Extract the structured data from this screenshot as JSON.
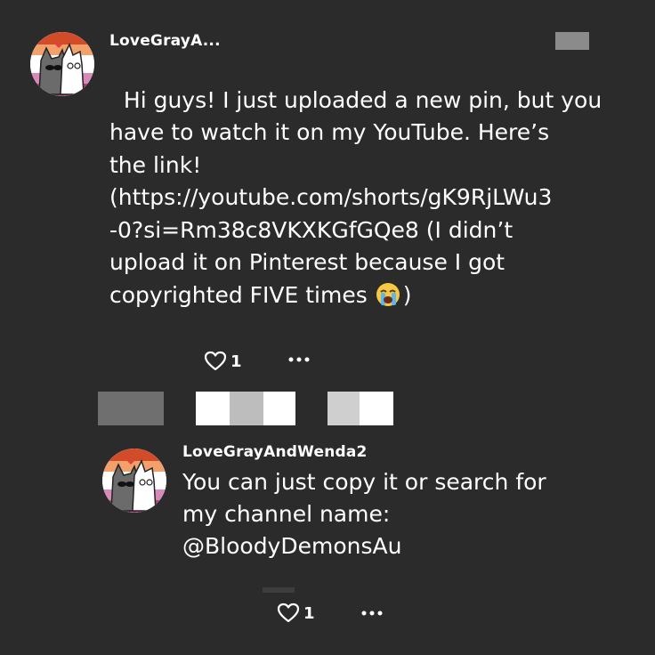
{
  "post": {
    "username": "LoveGrayA...",
    "text": "Hi guys! I just uploaded a new pin, but you\nhave to watch it on my YouTube. Here’s\nthe link!\n(https://youtube.com/shorts/gK9RjLWu3\n-0?si=Rm38c8VKXKGfGQe8 (I didn’t\nupload it on Pinterest because I got\ncopyrighted FIVE times ",
    "text_end": ")",
    "emoji_icon": "loudly-crying-face-icon",
    "like_count": "1"
  },
  "reply": {
    "username": "LoveGrayAndWenda2",
    "text": "You can just copy it or search for\nmy channel name:\n@BloodyDemonsAu",
    "like_count": "1"
  },
  "icons": {
    "like": "heart-outline-icon",
    "more": "more-dots-icon"
  },
  "colors": {
    "background": "#2b2b2b",
    "text": "#ffffff",
    "avatar_ring_top": "#d24c2a",
    "avatar_ring_mid": "#f3a06a",
    "avatar_ring_bottom": "#b33b7a"
  }
}
